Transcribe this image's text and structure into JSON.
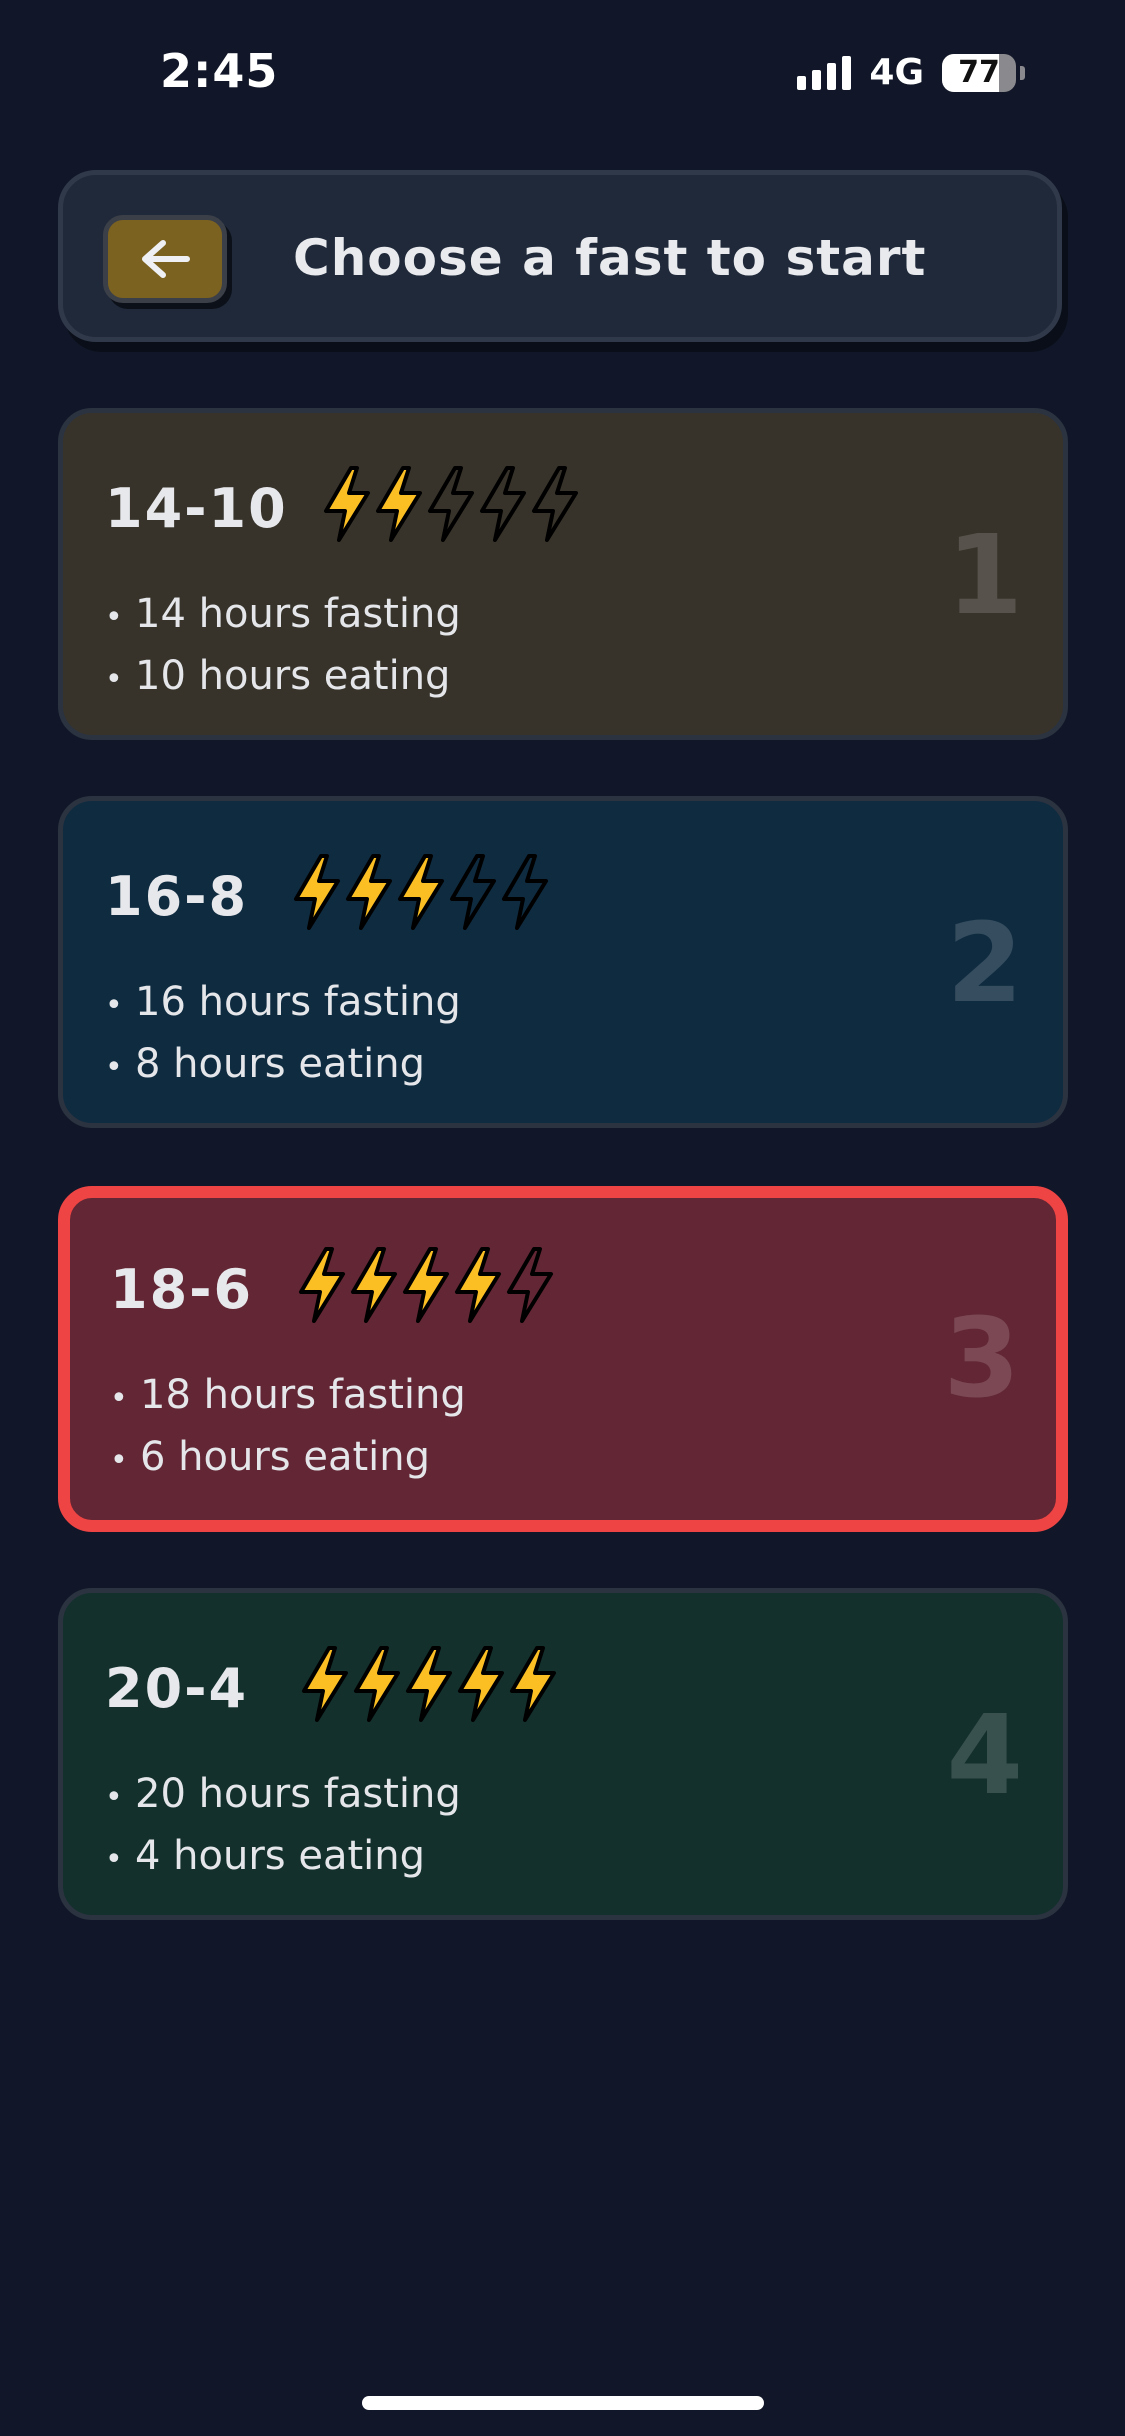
{
  "status_bar": {
    "time": "2:45",
    "network": "4G",
    "battery_level": 77,
    "battery_text": "77",
    "signal_bars": 4
  },
  "header": {
    "title": "Choose a fast to start",
    "back_icon": "arrow-left-icon"
  },
  "colors": {
    "background": "#111728",
    "bolt_filled": "#fbbf24",
    "bolt_outline": "#000000",
    "selected_border": "#ef4444"
  },
  "fasts": [
    {
      "name": "14-10",
      "rating": 2,
      "rating_max": 5,
      "line1": "14 hours fasting",
      "line2": "10 hours eating",
      "number": "1",
      "color": "#37332a",
      "selected": false
    },
    {
      "name": "16-8",
      "rating": 3,
      "rating_max": 5,
      "line1": "16 hours fasting",
      "line2": "8 hours eating",
      "number": "2",
      "color": "#0f2b40",
      "selected": false
    },
    {
      "name": "18-6",
      "rating": 4,
      "rating_max": 5,
      "line1": "18 hours fasting",
      "line2": "6 hours eating",
      "number": "3",
      "color": "#622634",
      "selected": true
    },
    {
      "name": "20-4",
      "rating": 5,
      "rating_max": 5,
      "line1": "20 hours fasting",
      "line2": "4 hours eating",
      "number": "4",
      "color": "#13302d",
      "selected": false
    }
  ]
}
